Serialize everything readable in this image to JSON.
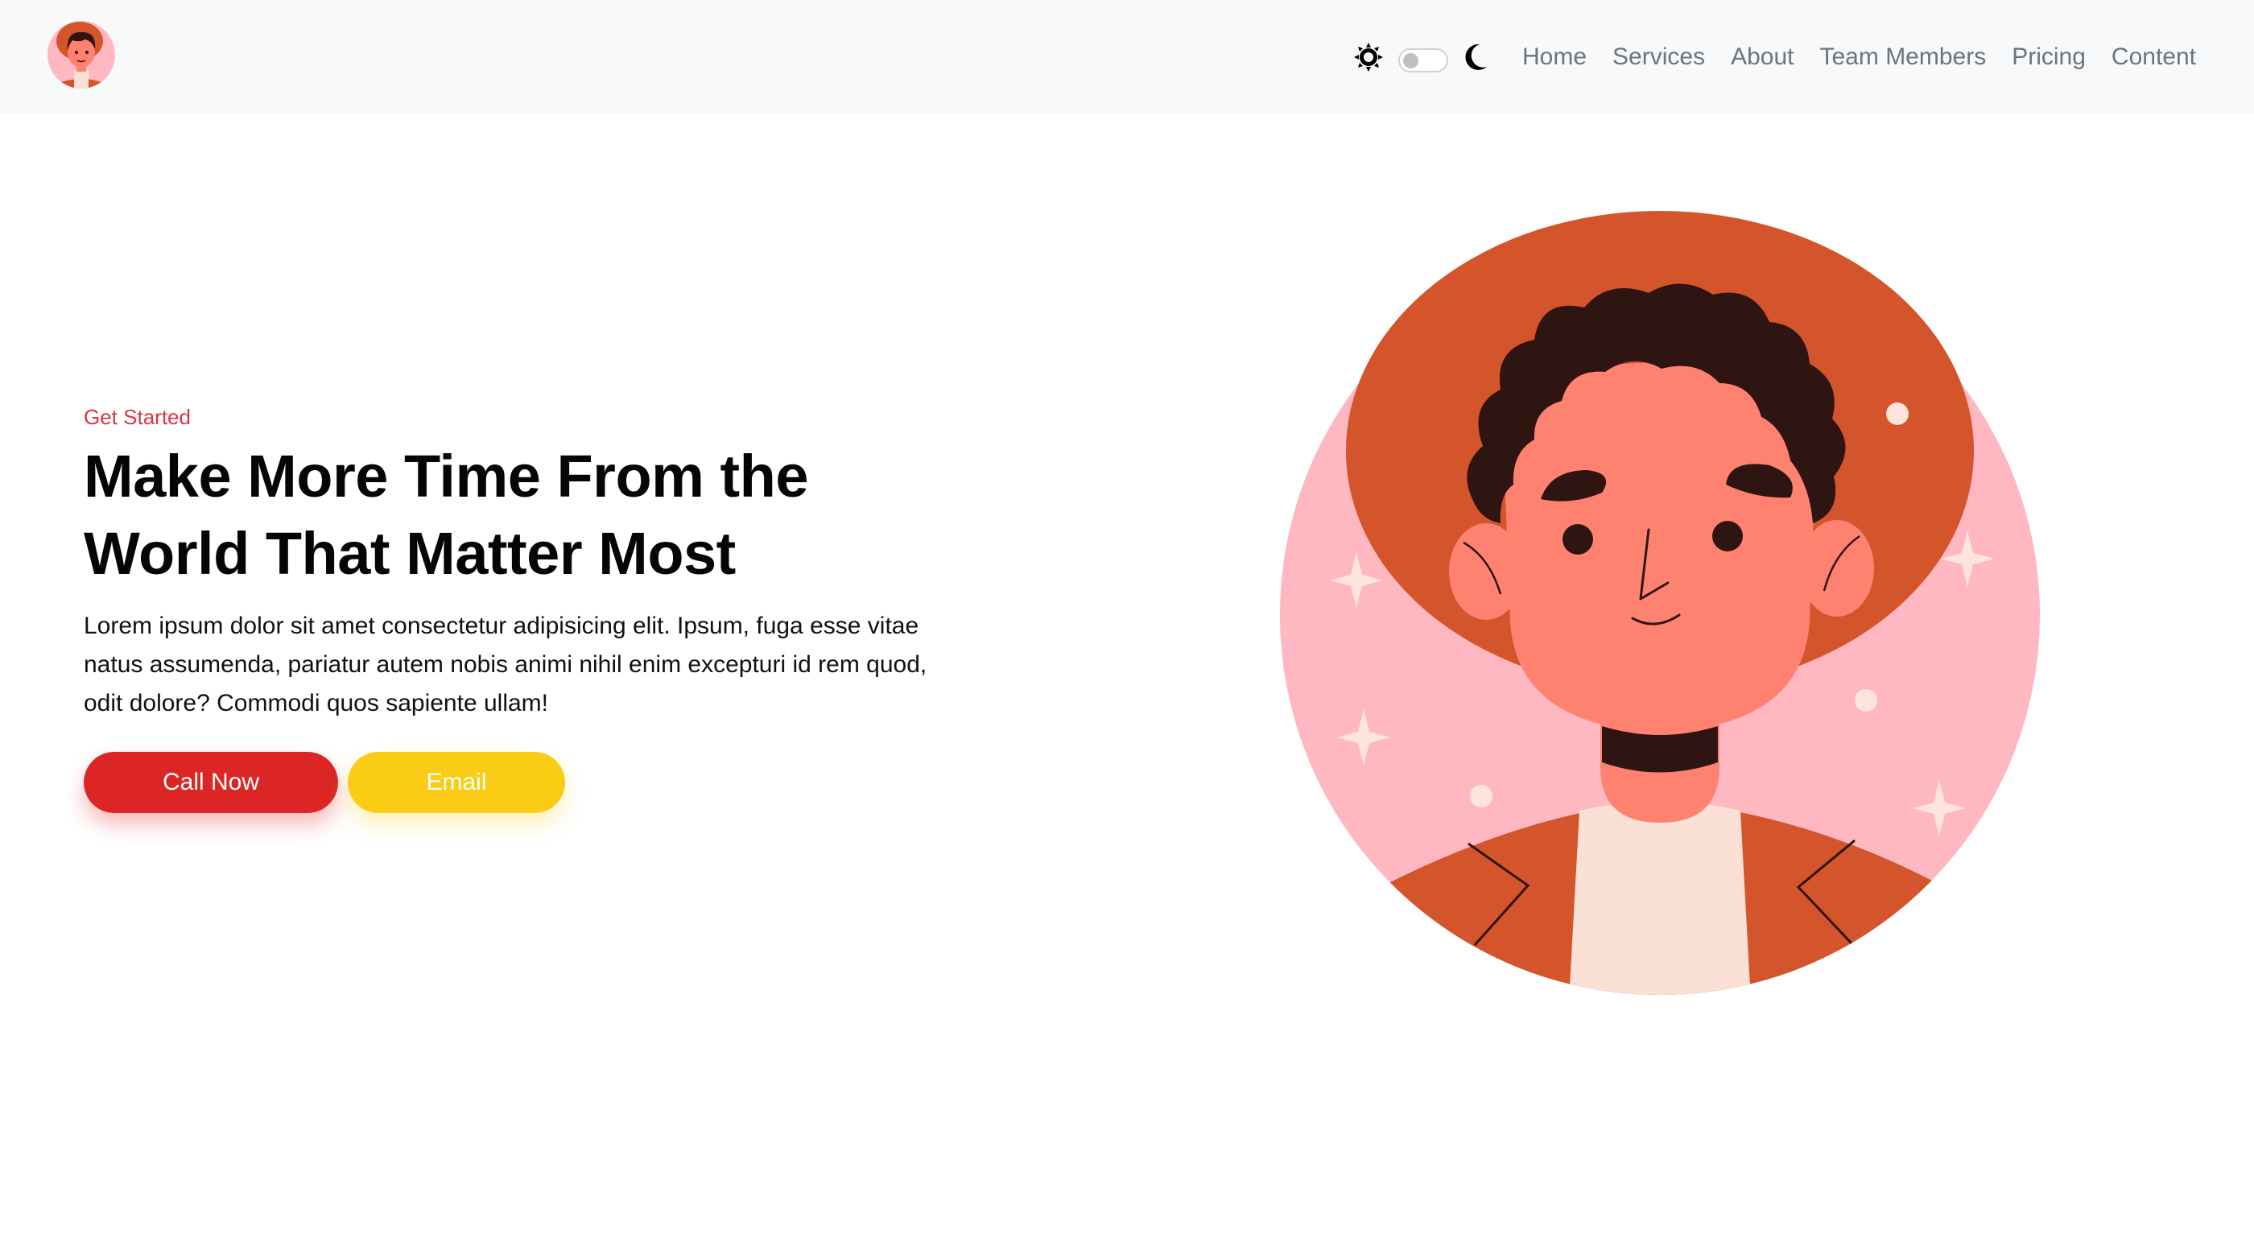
{
  "navbar": {
    "brand_icon": "avatar-logo-icon",
    "theme": {
      "light_icon": "sun-icon",
      "dark_icon": "moon-icon",
      "dark_mode": false
    },
    "links": [
      "Home",
      "Services",
      "About",
      "Team Members",
      "Pricing",
      "Content"
    ]
  },
  "hero": {
    "eyebrow": "Get Started",
    "title": "Make More Time From the World That Matter Most",
    "description": "Lorem ipsum dolor sit amet consectetur adipisicing elit. Ipsum, fuga esse vitae natus assumenda, pariatur autem nobis animi nihil enim excepturi id rem quod, odit dolore? Commodi quos sapiente ullam!",
    "primary_button": "Call Now",
    "secondary_button": "Email",
    "illustration": "man-avatar-illustration"
  },
  "colors": {
    "accent": "#dc3545",
    "primary_button": "#dc2626",
    "secondary_button": "#facc15",
    "navbar_bg": "#f8f9fa",
    "nav_link": "#6c757d",
    "illustration_bg": "#ffb8c1",
    "illustration_hat": "#d4542b",
    "illustration_skin": "#ff8270",
    "illustration_hair": "#2f1512"
  }
}
